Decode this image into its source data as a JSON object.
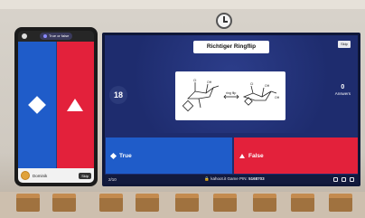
{
  "phone": {
    "mode_label": "True or false",
    "answers": [
      {
        "label": "True",
        "color": "#1f5cc9",
        "shape": "diamond"
      },
      {
        "label": "False",
        "color": "#e3213b",
        "shape": "triangle"
      }
    ],
    "player_name": "Dominik",
    "score_label": "Skip"
  },
  "screen": {
    "skip_label": "Skip",
    "question_title": "Richtiger Ringflip",
    "timer_value": "18",
    "answers_count": "0",
    "answers_label": "Answers",
    "answer_true": "True",
    "answer_false": "False",
    "progress": "2/10",
    "join_prefix": "kahoot.it",
    "pin_label": "Game PIN:",
    "pin_value": "5168703",
    "colors": {
      "blue": "#1f5cc9",
      "red": "#e3213b",
      "background": "#1e2c6e"
    }
  }
}
